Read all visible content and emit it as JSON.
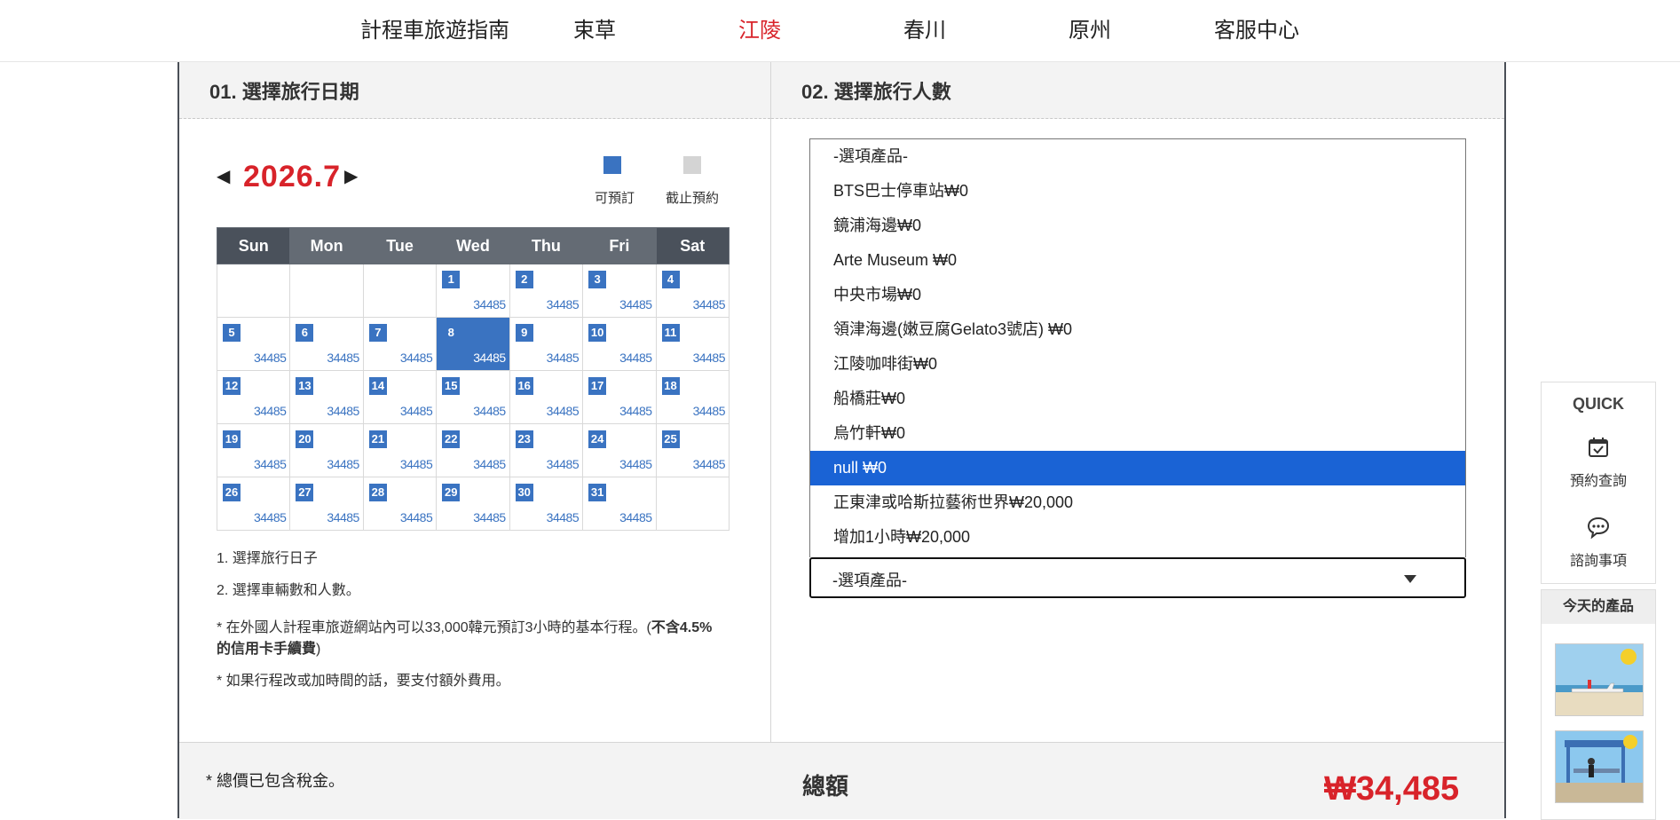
{
  "nav": {
    "items": [
      "計程車旅遊指南",
      "束草",
      "江陵",
      "春川",
      "原州",
      "客服中心"
    ],
    "active_index": 2,
    "active_color": "#d8232a"
  },
  "section1": {
    "title": "01. 選擇旅行日期",
    "month": "2026.7",
    "prev_icon": "triangle-left",
    "next_icon": "triangle-right",
    "legend_available": "可預訂",
    "legend_closed": "截止預約",
    "available_color": "#3a73c1",
    "closed_color": "#d4d4d4",
    "weekdays": [
      "Sun",
      "Mon",
      "Tue",
      "Wed",
      "Thu",
      "Fri",
      "Sat"
    ],
    "weeks": [
      [
        null,
        null,
        null,
        {
          "d": "1",
          "p": "34485"
        },
        {
          "d": "2",
          "p": "34485"
        },
        {
          "d": "3",
          "p": "34485"
        },
        {
          "d": "4",
          "p": "34485"
        }
      ],
      [
        {
          "d": "5",
          "p": "34485"
        },
        {
          "d": "6",
          "p": "34485"
        },
        {
          "d": "7",
          "p": "34485"
        },
        {
          "d": "8",
          "p": "34485",
          "selected": true
        },
        {
          "d": "9",
          "p": "34485"
        },
        {
          "d": "10",
          "p": "34485"
        },
        {
          "d": "11",
          "p": "34485"
        }
      ],
      [
        {
          "d": "12",
          "p": "34485"
        },
        {
          "d": "13",
          "p": "34485"
        },
        {
          "d": "14",
          "p": "34485"
        },
        {
          "d": "15",
          "p": "34485"
        },
        {
          "d": "16",
          "p": "34485"
        },
        {
          "d": "17",
          "p": "34485"
        },
        {
          "d": "18",
          "p": "34485"
        }
      ],
      [
        {
          "d": "19",
          "p": "34485"
        },
        {
          "d": "20",
          "p": "34485"
        },
        {
          "d": "21",
          "p": "34485"
        },
        {
          "d": "22",
          "p": "34485"
        },
        {
          "d": "23",
          "p": "34485"
        },
        {
          "d": "24",
          "p": "34485"
        },
        {
          "d": "25",
          "p": "34485"
        }
      ],
      [
        {
          "d": "26",
          "p": "34485"
        },
        {
          "d": "27",
          "p": "34485"
        },
        {
          "d": "28",
          "p": "34485"
        },
        {
          "d": "29",
          "p": "34485"
        },
        {
          "d": "30",
          "p": "34485"
        },
        {
          "d": "31",
          "p": "34485"
        },
        null
      ]
    ],
    "notes": {
      "n1": "1. 選擇旅行日子",
      "n2": "2. 選擇車輛數和人數。",
      "n3a": "* 在外國人計程車旅遊網站內可以33,000韓元預訂3小時的基本行程。(",
      "n3b": "不含4.5%的信用卡手續費",
      "n3c": ")",
      "n4": "* 如果行程改或加時間的話，要支付額外費用。"
    }
  },
  "section2": {
    "title": "02. 選擇旅行人數",
    "options": [
      "-選項產品-",
      "BTS巴士停車站₩0",
      "鏡浦海邊₩0",
      "Arte Museum ₩0",
      "中央市場₩0",
      "領津海邊(嫩豆腐Gelato3號店) ₩0",
      "江陵咖啡街₩0",
      "船橋莊₩0",
      "烏竹軒₩0",
      "null ₩0",
      "正東津或哈斯拉藝術世界₩20,000",
      "增加1小時₩20,000"
    ],
    "highlighted_index": 9,
    "selected_value": "-選項產品-"
  },
  "footer": {
    "tax_note": "* 總價已包含稅金。",
    "total_label": "總額",
    "total_value": "₩34,485"
  },
  "quick": {
    "title": "QUICK",
    "reservation_label": "預約查詢",
    "inquiry_label": "諮詢事項"
  },
  "today": {
    "title": "今天的產品"
  }
}
